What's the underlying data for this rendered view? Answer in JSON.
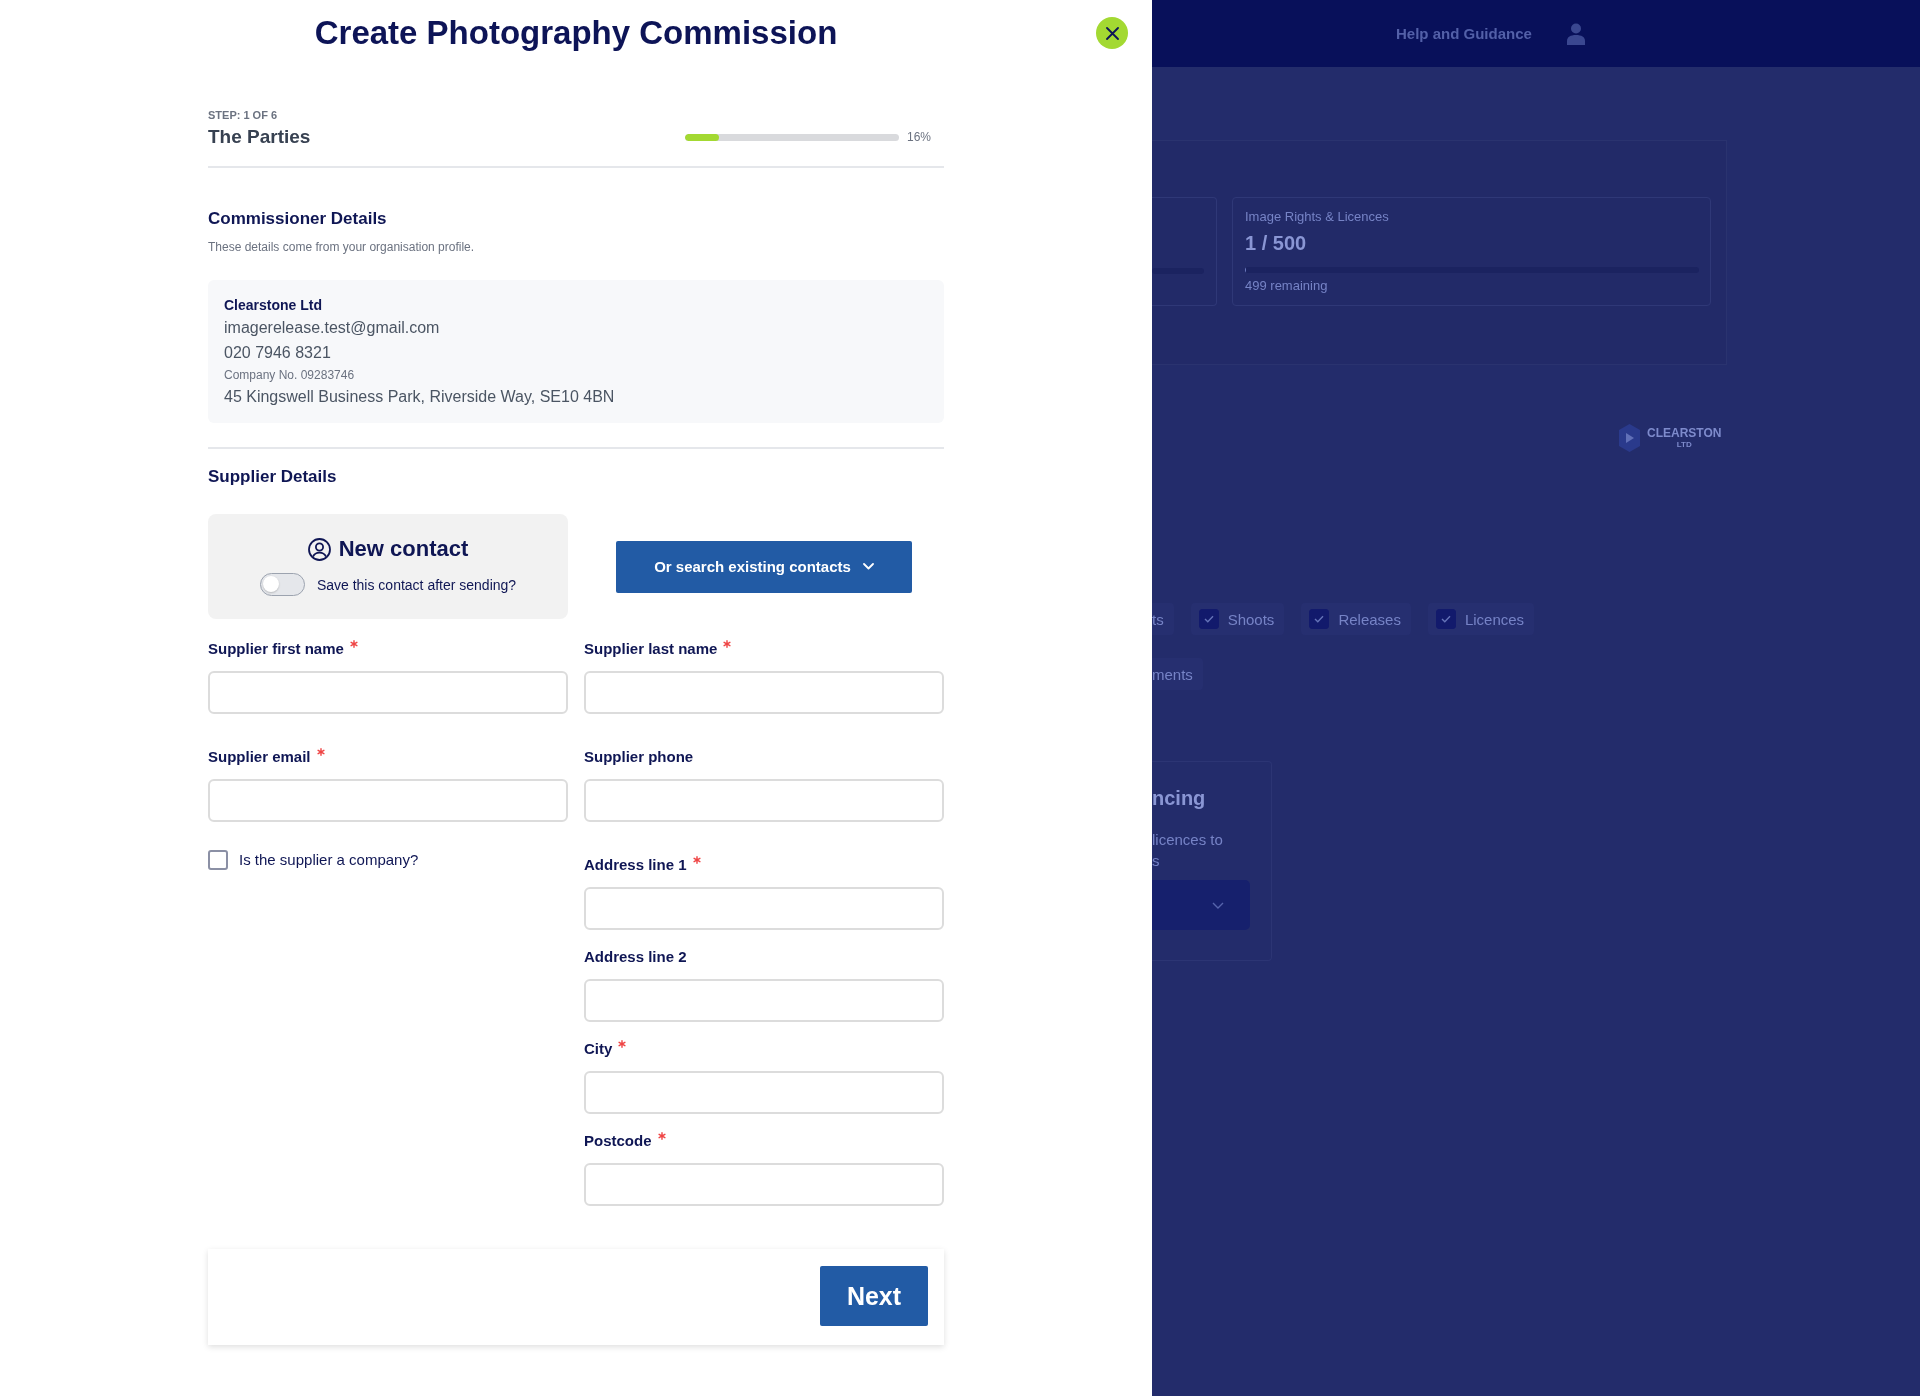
{
  "modal": {
    "title": "Create Photography Commission",
    "step": {
      "counter": "STEP: 1 OF 6",
      "name": "The Parties",
      "level": 0.16,
      "percent": "16%"
    },
    "commissioner": {
      "heading": "Commissioner Details",
      "description": "These details come from your organisation profile.",
      "company_name": "Clearstone Ltd",
      "email": "imagerelease.test@gmail.com",
      "phone": "020 7946 8321",
      "company_number": "Company No. 09283746",
      "address": "45 Kingswell Business Park, Riverside Way, SE10 4BN"
    },
    "supplier": {
      "heading": "Supplier Details",
      "new_contact": {
        "title": "New contact",
        "save_toggle": {
          "label": "Save this contact after sending?",
          "on": false
        }
      },
      "search_button": "Or search existing contacts",
      "fields": [
        {
          "label": "Supplier first name",
          "required": true
        },
        {
          "label": "Supplier last name",
          "required": true
        },
        {
          "label": "Supplier email",
          "required": true
        },
        {
          "label": "Supplier phone",
          "required": false
        }
      ],
      "company_checkbox": {
        "label": "Is the supplier a company?",
        "checked": false
      },
      "address_fields": [
        {
          "label": "Address line 1",
          "required": true
        },
        {
          "label": "Address line 2",
          "required": false
        },
        {
          "label": "City",
          "required": true
        },
        {
          "label": "Postcode",
          "required": true
        }
      ]
    },
    "next_button": "Next"
  },
  "background": {
    "header_link": "Help and Guidance",
    "usage_card": {
      "title": "Image Rights & Licences",
      "value": "1 / 500",
      "level": 0.002,
      "remaining": "499 remaining"
    },
    "logo": {
      "name": "CLEARSTON",
      "suffix": "LTD"
    },
    "filter_rows": [
      [
        {
          "kind": "cut",
          "label": "ts"
        },
        {
          "kind": "checkbox",
          "label": "Shoots",
          "checked": true
        },
        {
          "kind": "checkbox",
          "label": "Releases",
          "checked": true
        },
        {
          "kind": "checkbox",
          "label": "Licences",
          "checked": true
        }
      ],
      [
        {
          "kind": "cut",
          "label": "ments"
        }
      ]
    ],
    "feature_card": {
      "heading": "ncing",
      "lines": [
        "licences to",
        "s"
      ]
    }
  }
}
